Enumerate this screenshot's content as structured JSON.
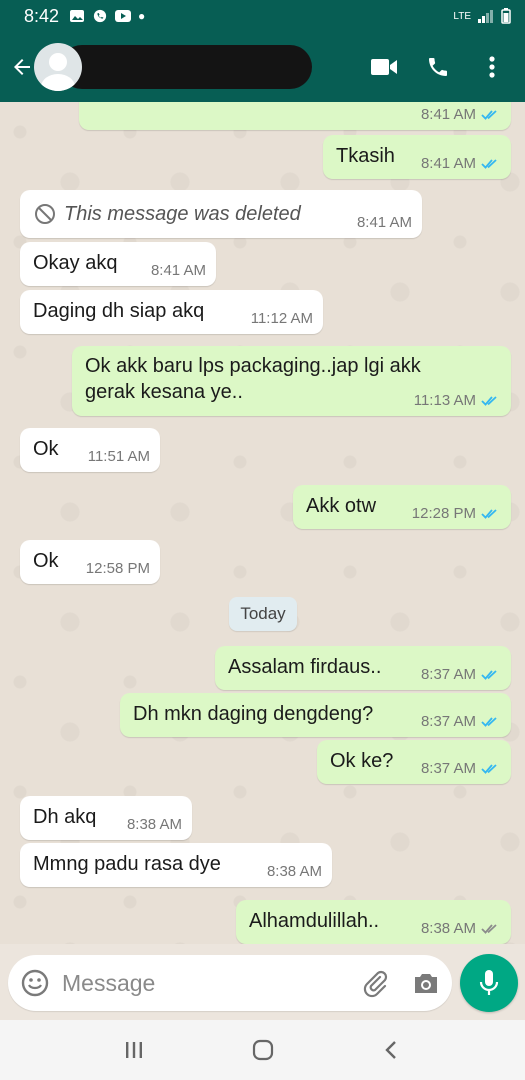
{
  "status_bar": {
    "time": "8:42",
    "network": "LTE"
  },
  "header": {
    "contact_name": ""
  },
  "messages": [
    {
      "dir": "out",
      "text": "",
      "time": "8:41 AM",
      "status": "read"
    },
    {
      "dir": "out",
      "text": "Tkasih",
      "time": "8:41 AM",
      "status": "read"
    },
    {
      "dir": "in",
      "text": "This message was deleted",
      "time": "8:41 AM",
      "deleted": true
    },
    {
      "dir": "in",
      "text": "Okay akq",
      "time": "8:41 AM"
    },
    {
      "dir": "in",
      "text": "Daging dh siap akq",
      "time": "11:12 AM"
    },
    {
      "dir": "out",
      "text_line1": "Ok akk baru lps packaging..jap lgi akk",
      "text_line2": "gerak kesana ye..",
      "time": "11:13 AM",
      "status": "read"
    },
    {
      "dir": "in",
      "text": "Ok",
      "time": "11:51 AM"
    },
    {
      "dir": "out",
      "text": "Akk otw",
      "time": "12:28 PM",
      "status": "read"
    },
    {
      "dir": "in",
      "text": "Ok",
      "time": "12:58 PM"
    },
    {
      "dir": "out",
      "text": "Assalam firdaus..",
      "time": "8:37 AM",
      "status": "read"
    },
    {
      "dir": "out",
      "text": "Dh mkn daging dengdeng?",
      "time": "8:37 AM",
      "status": "read"
    },
    {
      "dir": "out",
      "text": "Ok ke?",
      "time": "8:37 AM",
      "status": "read"
    },
    {
      "dir": "in",
      "text": "Dh akq",
      "time": "8:38 AM"
    },
    {
      "dir": "in",
      "text": "Mmng padu rasa dye",
      "time": "8:38 AM"
    },
    {
      "dir": "out",
      "text": "Alhamdulillah..",
      "time": "8:38 AM",
      "status": "delivered"
    }
  ],
  "day_separator": "Today",
  "composer": {
    "placeholder": "Message"
  },
  "colors": {
    "header": "#075e54",
    "outgoing": "#dcf8c6",
    "incoming": "#ffffff",
    "read_tick": "#34b7f1",
    "mic": "#00a884"
  },
  "icons": [
    "back-arrow-icon",
    "video-call-icon",
    "phone-icon",
    "more-vert-icon",
    "emoji-icon",
    "attach-icon",
    "camera-icon",
    "mic-icon",
    "deleted-icon"
  ]
}
